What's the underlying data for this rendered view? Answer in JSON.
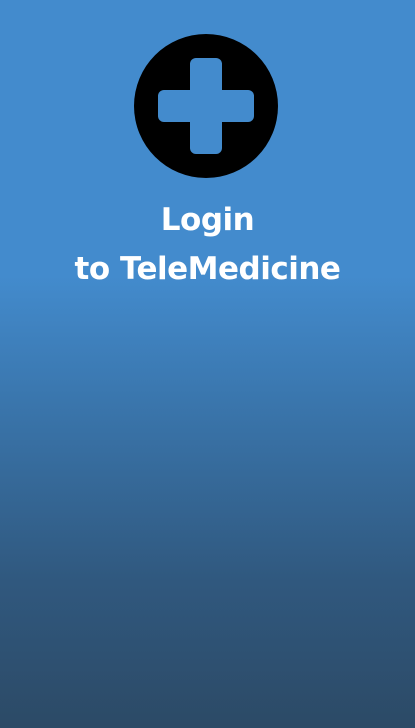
{
  "app": {
    "logo_icon": "medical-cross-icon",
    "colors": {
      "background_top": "#438BCD",
      "background_bottom": "#2C4A66",
      "logo_circle": "#000000",
      "logo_cross": "#438BCD",
      "text": "#FFFFFF"
    }
  },
  "header": {
    "title_line1": "Login",
    "title_line2": "to TeleMedicine"
  }
}
